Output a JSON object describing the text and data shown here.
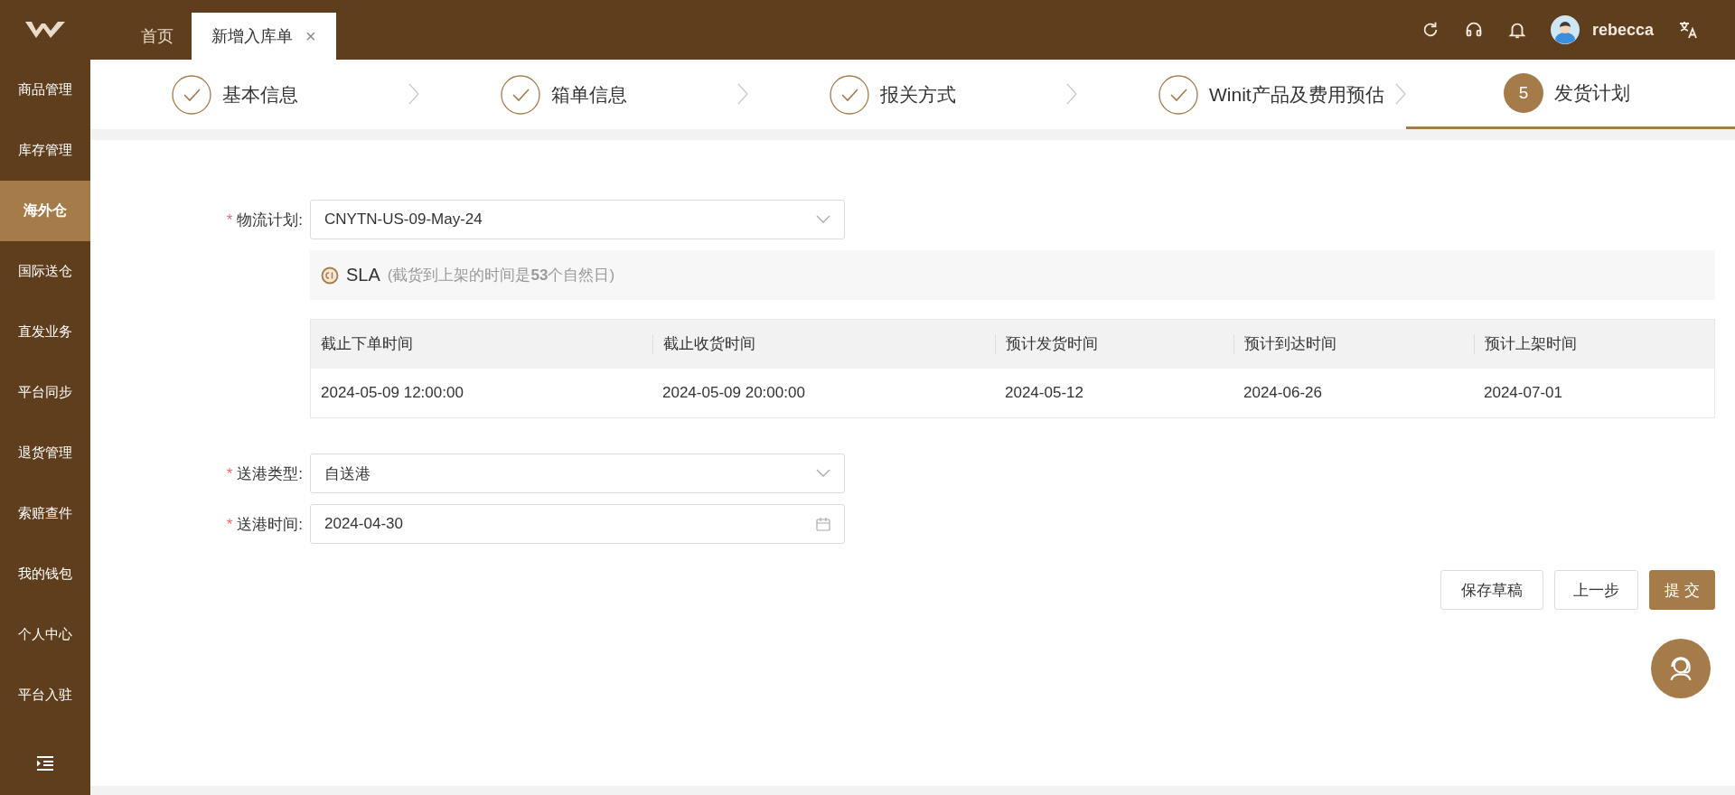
{
  "header": {
    "tabs": [
      {
        "label": "首页",
        "selected": false
      },
      {
        "label": "新增入库单",
        "selected": true,
        "close": "×"
      }
    ],
    "user": {
      "name": "rebecca"
    }
  },
  "sidebar": {
    "items": [
      {
        "label": "商品管理",
        "selected": false
      },
      {
        "label": "库存管理",
        "selected": false
      },
      {
        "label": "海外仓",
        "selected": true
      },
      {
        "label": "国际送仓",
        "selected": false
      },
      {
        "label": "直发业务",
        "selected": false
      },
      {
        "label": "平台同步",
        "selected": false
      },
      {
        "label": "退货管理",
        "selected": false
      },
      {
        "label": "索赔查件",
        "selected": false
      },
      {
        "label": "我的钱包",
        "selected": false
      },
      {
        "label": "个人中心",
        "selected": false
      },
      {
        "label": "平台入驻",
        "selected": false
      }
    ]
  },
  "steps": [
    {
      "label": "基本信息",
      "kind": "done",
      "selected": false
    },
    {
      "label": "箱单信息",
      "kind": "done",
      "selected": false
    },
    {
      "label": "报关方式",
      "kind": "done",
      "selected": false
    },
    {
      "label": "Winit产品及费用预估",
      "kind": "done",
      "selected": false
    },
    {
      "label": "发货计划",
      "kind": "current",
      "number": "5",
      "selected": true
    }
  ],
  "form": {
    "fields": [
      {
        "mark": "*",
        "label": "物流计划:",
        "kind": "select",
        "value": "CNYTN-US-09-May-24"
      }
    ],
    "sla": {
      "title": "SLA",
      "note": "(截货到上架的时间是**53**个自然日)"
    },
    "table": {
      "columns": [
        "截止下单时间",
        "截止收货时间",
        "预计发货时间",
        "预计到达时间",
        "预计上架时间"
      ],
      "rows": [
        [
          "2024-05-09 12:00:00",
          "2024-05-09 20:00:00",
          "2024-05-12",
          "2024-06-26",
          "2024-07-01"
        ]
      ]
    },
    "fields_after": [
      {
        "mark": "*",
        "label": "送港类型:",
        "kind": "select",
        "value": "自送港"
      },
      {
        "mark": "*",
        "label": "送港时间:",
        "kind": "date",
        "value": "2024-04-30"
      }
    ]
  },
  "buttons": [
    {
      "label": "保存草稿",
      "kind": "default"
    },
    {
      "label": "上一步",
      "kind": "default"
    },
    {
      "label": "提 交",
      "kind": "primary"
    }
  ]
}
